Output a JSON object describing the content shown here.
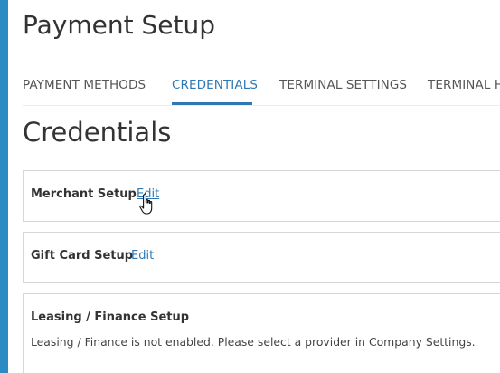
{
  "page": {
    "title": "Payment Setup"
  },
  "tabs": [
    {
      "label": "PAYMENT METHODS",
      "active": false
    },
    {
      "label": "CREDENTIALS",
      "active": true
    },
    {
      "label": "TERMINAL SETTINGS",
      "active": false
    },
    {
      "label": "TERMINAL H",
      "active": false
    }
  ],
  "section": {
    "heading": "Credentials"
  },
  "panels": {
    "merchant": {
      "title": "Merchant Setup",
      "edit_label": "Edit"
    },
    "gift_card": {
      "title": "Gift Card Setup",
      "edit_label": "Edit"
    },
    "leasing": {
      "title": "Leasing / Finance Setup",
      "message": "Leasing / Finance is not enabled. Please select a provider in Company Settings."
    }
  },
  "colors": {
    "accent": "#2f78b4",
    "left_bar": "#2b8cc4",
    "border": "#d8d8d8"
  },
  "icons": {
    "cursor": "hand-pointer-icon"
  }
}
